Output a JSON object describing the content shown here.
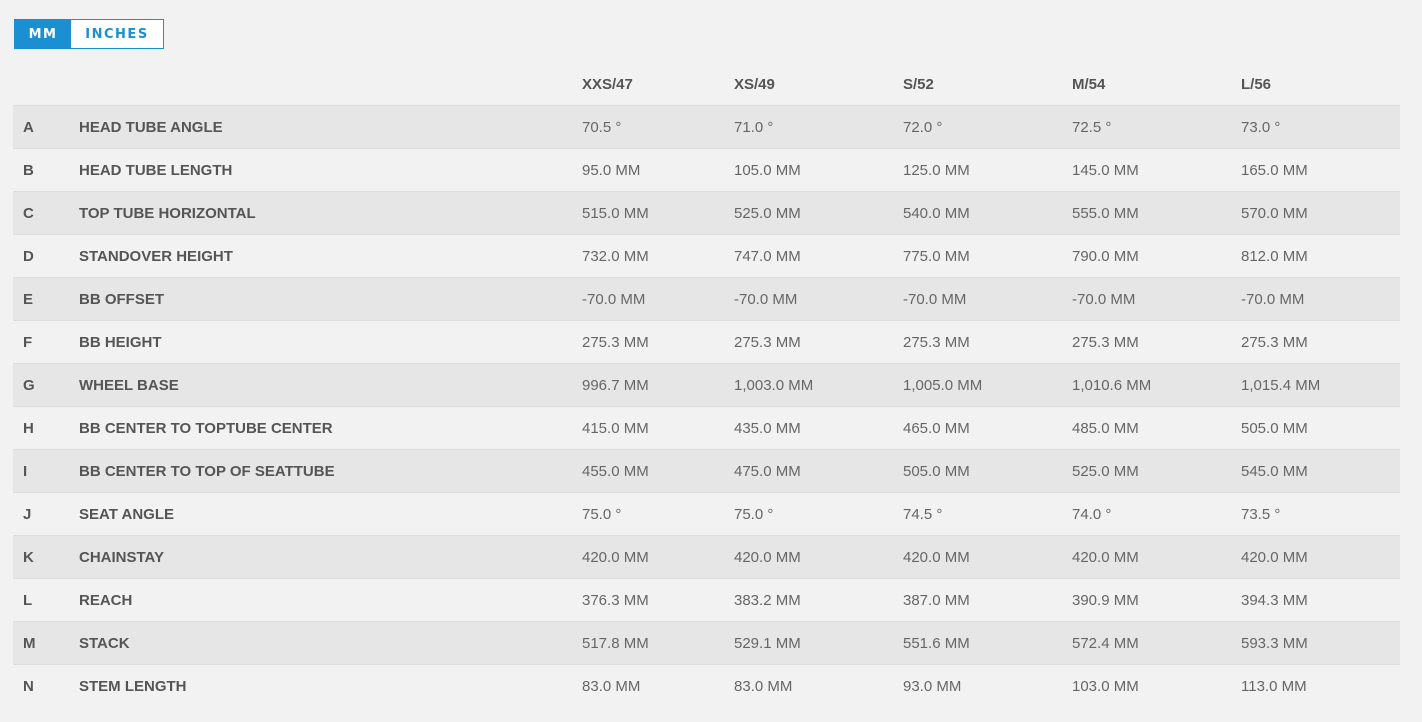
{
  "unit_toggle": {
    "mm_label": "MM",
    "inches_label": "INCHES",
    "active": "MM",
    "accent_color": "#1a8fd2"
  },
  "table": {
    "columns": [
      "XXS/47",
      "XS/49",
      "S/52",
      "M/54",
      "L/56"
    ],
    "rows": [
      {
        "key": "A",
        "label": "HEAD TUBE ANGLE",
        "values": [
          "70.5 °",
          "71.0 °",
          "72.0 °",
          "72.5 °",
          "73.0 °"
        ]
      },
      {
        "key": "B",
        "label": "HEAD TUBE LENGTH",
        "values": [
          "95.0 MM",
          "105.0 MM",
          "125.0 MM",
          "145.0 MM",
          "165.0 MM"
        ]
      },
      {
        "key": "C",
        "label": "TOP TUBE HORIZONTAL",
        "values": [
          "515.0 MM",
          "525.0 MM",
          "540.0 MM",
          "555.0 MM",
          "570.0 MM"
        ]
      },
      {
        "key": "D",
        "label": "STANDOVER HEIGHT",
        "values": [
          "732.0 MM",
          "747.0 MM",
          "775.0 MM",
          "790.0 MM",
          "812.0 MM"
        ]
      },
      {
        "key": "E",
        "label": "BB OFFSET",
        "values": [
          "-70.0 MM",
          "-70.0 MM",
          "-70.0 MM",
          "-70.0 MM",
          "-70.0 MM"
        ]
      },
      {
        "key": "F",
        "label": "BB HEIGHT",
        "values": [
          "275.3 MM",
          "275.3 MM",
          "275.3 MM",
          "275.3 MM",
          "275.3 MM"
        ]
      },
      {
        "key": "G",
        "label": "WHEEL BASE",
        "values": [
          "996.7 MM",
          "1,003.0 MM",
          "1,005.0 MM",
          "1,010.6 MM",
          "1,015.4 MM"
        ]
      },
      {
        "key": "H",
        "label": "BB CENTER TO TOPTUBE CENTER",
        "values": [
          "415.0 MM",
          "435.0 MM",
          "465.0 MM",
          "485.0 MM",
          "505.0 MM"
        ]
      },
      {
        "key": "I",
        "label": "BB CENTER TO TOP OF SEATTUBE",
        "values": [
          "455.0 MM",
          "475.0 MM",
          "505.0 MM",
          "525.0 MM",
          "545.0 MM"
        ]
      },
      {
        "key": "J",
        "label": "SEAT ANGLE",
        "values": [
          "75.0 °",
          "75.0 °",
          "74.5 °",
          "74.0 °",
          "73.5 °"
        ]
      },
      {
        "key": "K",
        "label": "CHAINSTAY",
        "values": [
          "420.0 MM",
          "420.0 MM",
          "420.0 MM",
          "420.0 MM",
          "420.0 MM"
        ]
      },
      {
        "key": "L",
        "label": "REACH",
        "values": [
          "376.3 MM",
          "383.2 MM",
          "387.0 MM",
          "390.9 MM",
          "394.3 MM"
        ]
      },
      {
        "key": "M",
        "label": "STACK",
        "values": [
          "517.8 MM",
          "529.1 MM",
          "551.6 MM",
          "572.4 MM",
          "593.3 MM"
        ]
      },
      {
        "key": "N",
        "label": "STEM LENGTH",
        "values": [
          "83.0 MM",
          "83.0 MM",
          "93.0 MM",
          "103.0 MM",
          "113.0 MM"
        ]
      }
    ]
  }
}
